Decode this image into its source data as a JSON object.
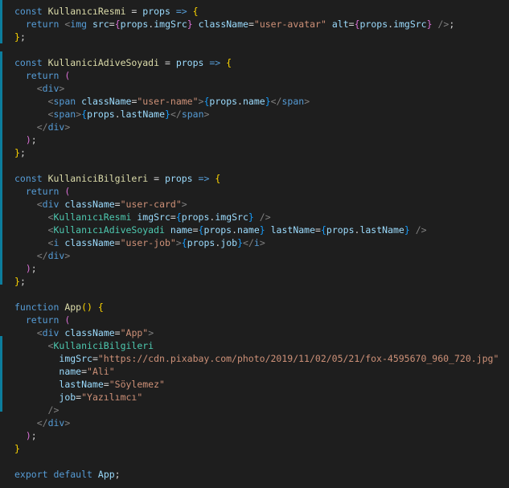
{
  "colors": {
    "background": "#1e1e1e",
    "keyword": "#569cd6",
    "function": "#dcdcaa",
    "variable": "#9cdcfe",
    "component": "#4ec9b0",
    "string": "#ce9178",
    "bracket_gold": "#ffd700",
    "bracket_purple": "#da70d6",
    "bracket_blue": "#179fff",
    "gutter_change_marker": "#0c7d9d"
  },
  "editor": {
    "lines": [
      [
        [
          "kw",
          "const"
        ],
        [
          "pun",
          " "
        ],
        [
          "fn",
          "KullanıcıResmi"
        ],
        [
          "pun",
          " = "
        ],
        [
          "var",
          "props"
        ],
        [
          "kw",
          " =>"
        ],
        [
          "pun",
          " "
        ],
        [
          "br1",
          "{"
        ]
      ],
      [
        [
          "pun",
          "  "
        ],
        [
          "kw",
          "return"
        ],
        [
          "pun",
          " "
        ],
        [
          "ang",
          "<"
        ],
        [
          "tag",
          "img"
        ],
        [
          "pun",
          " "
        ],
        [
          "attr",
          "src"
        ],
        [
          "pun",
          "="
        ],
        [
          "br2",
          "{"
        ],
        [
          "var",
          "props"
        ],
        [
          "pun",
          "."
        ],
        [
          "var",
          "imgSrc"
        ],
        [
          "br2",
          "}"
        ],
        [
          "pun",
          " "
        ],
        [
          "attr",
          "className"
        ],
        [
          "pun",
          "="
        ],
        [
          "str",
          "\"user-avatar\""
        ],
        [
          "pun",
          " "
        ],
        [
          "attr",
          "alt"
        ],
        [
          "pun",
          "="
        ],
        [
          "br2",
          "{"
        ],
        [
          "var",
          "props"
        ],
        [
          "pun",
          "."
        ],
        [
          "var",
          "imgSrc"
        ],
        [
          "br2",
          "}"
        ],
        [
          "pun",
          " "
        ],
        [
          "ang",
          "/>"
        ],
        [
          "pun",
          ";"
        ]
      ],
      [
        [
          "br1",
          "}"
        ],
        [
          "pun",
          ";"
        ]
      ],
      [],
      [
        [
          "kw",
          "const"
        ],
        [
          "pun",
          " "
        ],
        [
          "fn",
          "KullaniciAdiveSoyadi"
        ],
        [
          "pun",
          " = "
        ],
        [
          "var",
          "props"
        ],
        [
          "kw",
          " =>"
        ],
        [
          "pun",
          " "
        ],
        [
          "br1",
          "{"
        ]
      ],
      [
        [
          "pun",
          "  "
        ],
        [
          "kw",
          "return"
        ],
        [
          "pun",
          " "
        ],
        [
          "br2",
          "("
        ]
      ],
      [
        [
          "pun",
          "    "
        ],
        [
          "ang",
          "<"
        ],
        [
          "tag",
          "div"
        ],
        [
          "ang",
          ">"
        ]
      ],
      [
        [
          "pun",
          "      "
        ],
        [
          "ang",
          "<"
        ],
        [
          "tag",
          "span"
        ],
        [
          "pun",
          " "
        ],
        [
          "attr",
          "className"
        ],
        [
          "pun",
          "="
        ],
        [
          "str",
          "\"user-name\""
        ],
        [
          "ang",
          ">"
        ],
        [
          "br3",
          "{"
        ],
        [
          "var",
          "props"
        ],
        [
          "pun",
          "."
        ],
        [
          "var",
          "name"
        ],
        [
          "br3",
          "}"
        ],
        [
          "ang",
          "</"
        ],
        [
          "tag",
          "span"
        ],
        [
          "ang",
          ">"
        ]
      ],
      [
        [
          "pun",
          "      "
        ],
        [
          "ang",
          "<"
        ],
        [
          "tag",
          "span"
        ],
        [
          "ang",
          ">"
        ],
        [
          "br3",
          "{"
        ],
        [
          "var",
          "props"
        ],
        [
          "pun",
          "."
        ],
        [
          "var",
          "lastName"
        ],
        [
          "br3",
          "}"
        ],
        [
          "ang",
          "</"
        ],
        [
          "tag",
          "span"
        ],
        [
          "ang",
          ">"
        ]
      ],
      [
        [
          "pun",
          "    "
        ],
        [
          "ang",
          "</"
        ],
        [
          "tag",
          "div"
        ],
        [
          "ang",
          ">"
        ]
      ],
      [
        [
          "pun",
          "  "
        ],
        [
          "br2",
          ")"
        ],
        [
          "pun",
          ";"
        ]
      ],
      [
        [
          "br1",
          "}"
        ],
        [
          "pun",
          ";"
        ]
      ],
      [],
      [
        [
          "kw",
          "const"
        ],
        [
          "pun",
          " "
        ],
        [
          "fn",
          "KullaniciBilgileri"
        ],
        [
          "pun",
          " = "
        ],
        [
          "var",
          "props"
        ],
        [
          "kw",
          " =>"
        ],
        [
          "pun",
          " "
        ],
        [
          "br1",
          "{"
        ]
      ],
      [
        [
          "pun",
          "  "
        ],
        [
          "kw",
          "return"
        ],
        [
          "pun",
          " "
        ],
        [
          "br2",
          "("
        ]
      ],
      [
        [
          "pun",
          "    "
        ],
        [
          "ang",
          "<"
        ],
        [
          "tag",
          "div"
        ],
        [
          "pun",
          " "
        ],
        [
          "attr",
          "className"
        ],
        [
          "pun",
          "="
        ],
        [
          "str",
          "\"user-card\""
        ],
        [
          "ang",
          ">"
        ]
      ],
      [
        [
          "pun",
          "      "
        ],
        [
          "ang",
          "<"
        ],
        [
          "cmp",
          "KullanıcıResmi"
        ],
        [
          "pun",
          " "
        ],
        [
          "attr",
          "imgSrc"
        ],
        [
          "pun",
          "="
        ],
        [
          "br3",
          "{"
        ],
        [
          "var",
          "props"
        ],
        [
          "pun",
          "."
        ],
        [
          "var",
          "imgSrc"
        ],
        [
          "br3",
          "}"
        ],
        [
          "pun",
          " "
        ],
        [
          "ang",
          "/>"
        ]
      ],
      [
        [
          "pun",
          "      "
        ],
        [
          "ang",
          "<"
        ],
        [
          "cmp",
          "KullanıcıAdiveSoyadi"
        ],
        [
          "pun",
          " "
        ],
        [
          "attr",
          "name"
        ],
        [
          "pun",
          "="
        ],
        [
          "br3",
          "{"
        ],
        [
          "var",
          "props"
        ],
        [
          "pun",
          "."
        ],
        [
          "var",
          "name"
        ],
        [
          "br3",
          "}"
        ],
        [
          "pun",
          " "
        ],
        [
          "attr",
          "lastName"
        ],
        [
          "pun",
          "="
        ],
        [
          "br3",
          "{"
        ],
        [
          "var",
          "props"
        ],
        [
          "pun",
          "."
        ],
        [
          "var",
          "lastName"
        ],
        [
          "br3",
          "}"
        ],
        [
          "pun",
          " "
        ],
        [
          "ang",
          "/>"
        ]
      ],
      [
        [
          "pun",
          "      "
        ],
        [
          "ang",
          "<"
        ],
        [
          "tag",
          "i"
        ],
        [
          "pun",
          " "
        ],
        [
          "attr",
          "className"
        ],
        [
          "pun",
          "="
        ],
        [
          "str",
          "\"user-job\""
        ],
        [
          "ang",
          ">"
        ],
        [
          "br3",
          "{"
        ],
        [
          "var",
          "props"
        ],
        [
          "pun",
          "."
        ],
        [
          "var",
          "job"
        ],
        [
          "br3",
          "}"
        ],
        [
          "ang",
          "</"
        ],
        [
          "tag",
          "i"
        ],
        [
          "ang",
          ">"
        ]
      ],
      [
        [
          "pun",
          "    "
        ],
        [
          "ang",
          "</"
        ],
        [
          "tag",
          "div"
        ],
        [
          "ang",
          ">"
        ]
      ],
      [
        [
          "pun",
          "  "
        ],
        [
          "br2",
          ")"
        ],
        [
          "pun",
          ";"
        ]
      ],
      [
        [
          "br1",
          "}"
        ],
        [
          "pun",
          ";"
        ]
      ],
      [],
      [
        [
          "kw",
          "function"
        ],
        [
          "pun",
          " "
        ],
        [
          "fn",
          "App"
        ],
        [
          "br1",
          "()"
        ],
        [
          "pun",
          " "
        ],
        [
          "br1",
          "{"
        ]
      ],
      [
        [
          "pun",
          "  "
        ],
        [
          "kw",
          "return"
        ],
        [
          "pun",
          " "
        ],
        [
          "br2",
          "("
        ]
      ],
      [
        [
          "pun",
          "    "
        ],
        [
          "ang",
          "<"
        ],
        [
          "tag",
          "div"
        ],
        [
          "pun",
          " "
        ],
        [
          "attr",
          "className"
        ],
        [
          "pun",
          "="
        ],
        [
          "str",
          "\"App\""
        ],
        [
          "ang",
          ">"
        ]
      ],
      [
        [
          "pun",
          "      "
        ],
        [
          "ang",
          "<"
        ],
        [
          "cmp",
          "KullaniciBilgileri"
        ]
      ],
      [
        [
          "pun",
          "        "
        ],
        [
          "attr",
          "imgSrc"
        ],
        [
          "pun",
          "="
        ],
        [
          "str",
          "\"https://cdn.pixabay.com/photo/2019/11/02/05/21/fox-4595670_960_720.jpg\""
        ]
      ],
      [
        [
          "pun",
          "        "
        ],
        [
          "attr",
          "name"
        ],
        [
          "pun",
          "="
        ],
        [
          "str",
          "\"Ali\""
        ]
      ],
      [
        [
          "pun",
          "        "
        ],
        [
          "attr",
          "lastName"
        ],
        [
          "pun",
          "="
        ],
        [
          "str",
          "\"Söylemez\""
        ]
      ],
      [
        [
          "pun",
          "        "
        ],
        [
          "attr",
          "job"
        ],
        [
          "pun",
          "="
        ],
        [
          "str",
          "\"Yazılımcı\""
        ]
      ],
      [
        [
          "pun",
          "      "
        ],
        [
          "ang",
          "/>"
        ]
      ],
      [
        [
          "pun",
          "    "
        ],
        [
          "ang",
          "</"
        ],
        [
          "tag",
          "div"
        ],
        [
          "ang",
          ">"
        ]
      ],
      [
        [
          "pun",
          "  "
        ],
        [
          "br2",
          ")"
        ],
        [
          "pun",
          ";"
        ]
      ],
      [
        [
          "br1",
          "}"
        ]
      ],
      [],
      [
        [
          "kw",
          "export"
        ],
        [
          "pun",
          " "
        ],
        [
          "kw",
          "default"
        ],
        [
          "pun",
          " "
        ],
        [
          "var",
          "App"
        ],
        [
          "pun",
          ";"
        ]
      ]
    ]
  }
}
